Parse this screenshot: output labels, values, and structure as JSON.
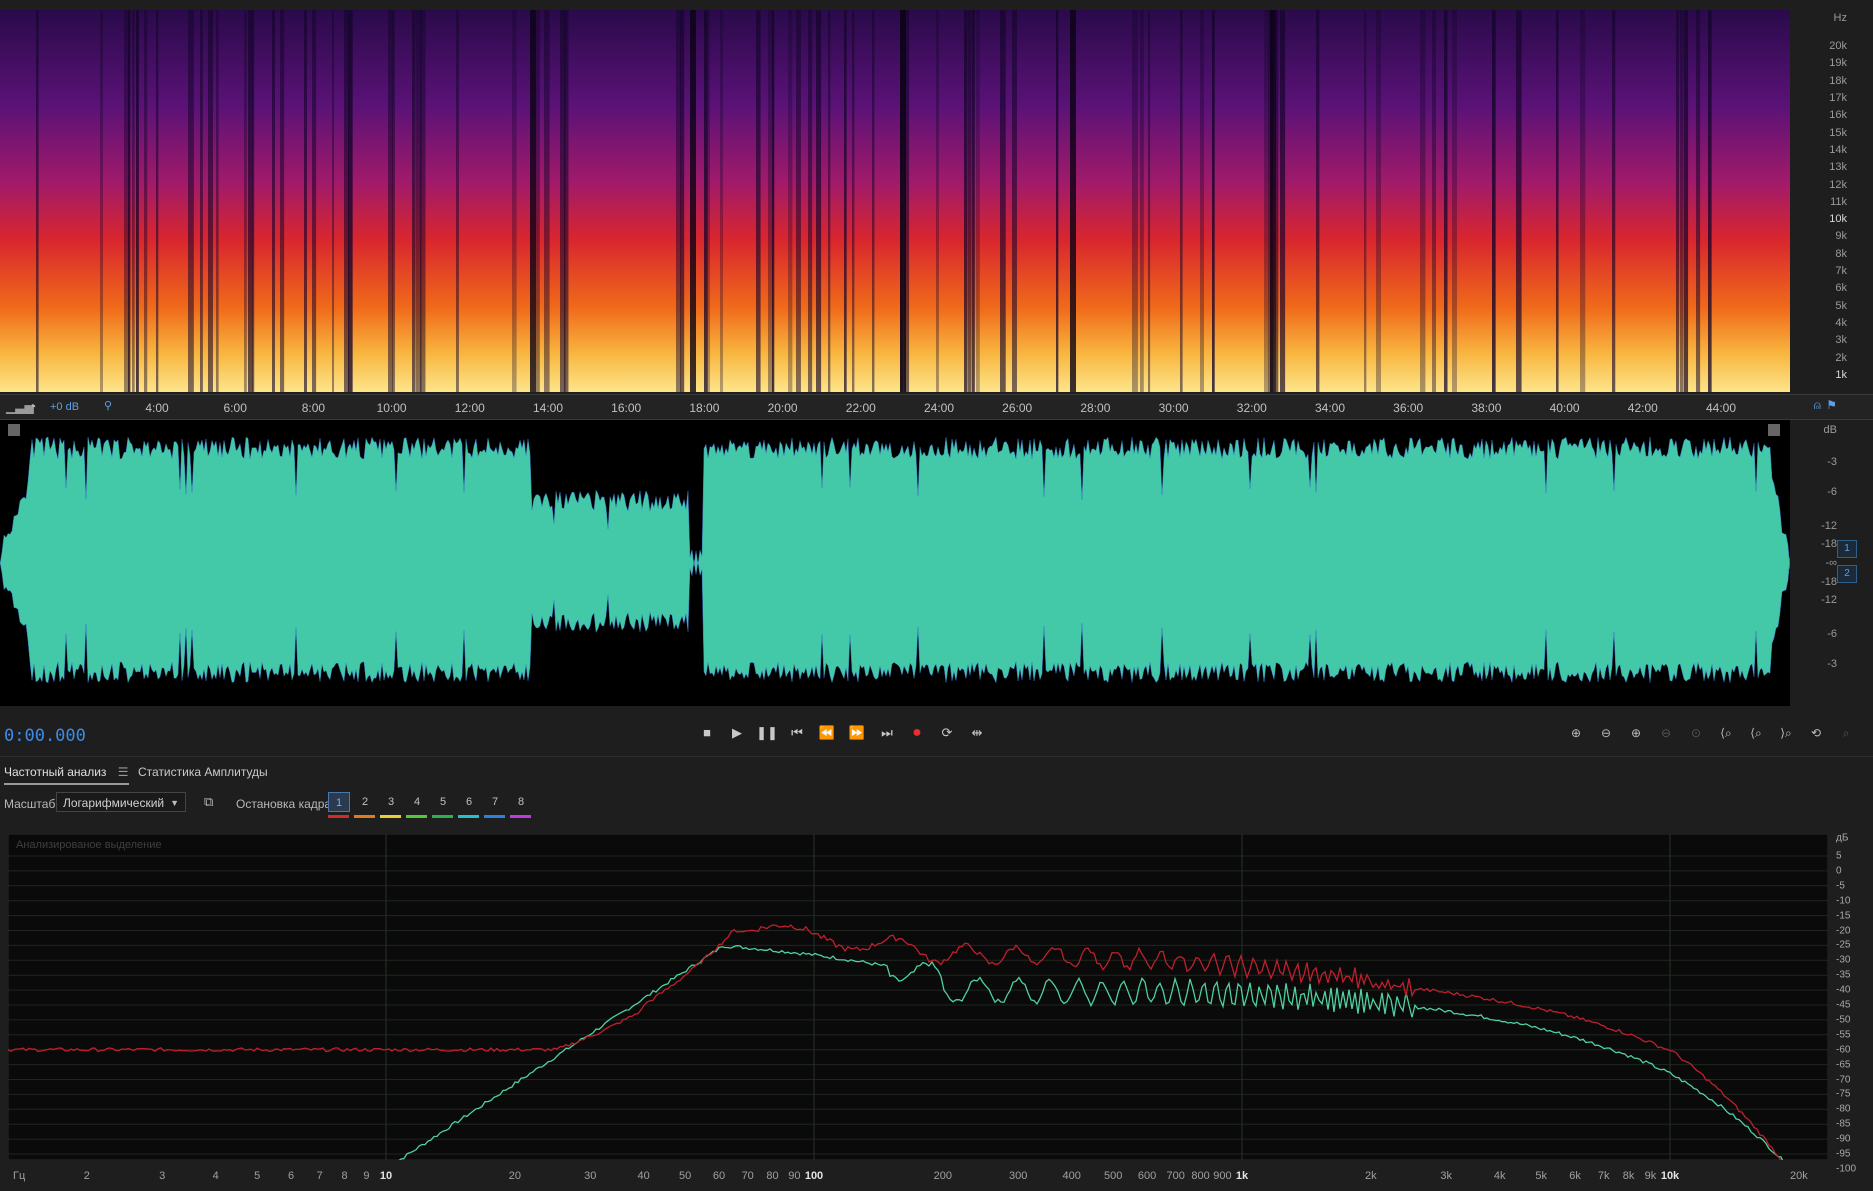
{
  "spectral": {
    "hz_unit": "Hz",
    "hz_labels": [
      "20k",
      "19k",
      "18k",
      "17k",
      "16k",
      "15k",
      "14k",
      "13k",
      "12k",
      "11k",
      "10k",
      "9k",
      "8k",
      "7k",
      "6k",
      "5k",
      "4k",
      "3k",
      "2k",
      "1k"
    ]
  },
  "timeline": {
    "gain": "+0 dB",
    "ticks": [
      "4:00",
      "6:00",
      "8:00",
      "10:00",
      "12:00",
      "14:00",
      "16:00",
      "18:00",
      "20:00",
      "22:00",
      "24:00",
      "26:00",
      "28:00",
      "30:00",
      "32:00",
      "34:00",
      "36:00",
      "38:00",
      "40:00",
      "42:00",
      "44:00"
    ]
  },
  "waveform": {
    "db_unit": "dB",
    "db_labels": [
      "-3",
      "-6",
      "-12",
      "-18",
      "-∞",
      "-18",
      "-12",
      "-6",
      "-3"
    ],
    "channels": [
      "1",
      "2"
    ],
    "color": "#44c9a8"
  },
  "transport": {
    "timecode": "0:00.000"
  },
  "panel": {
    "tabs": [
      "Частотный анализ",
      "Статистика Амплитуды"
    ],
    "scale_label": "Масштаб:",
    "scale_value": "Логарифмический",
    "freeze_label": "Остановка кадра:",
    "frames": [
      "1",
      "2",
      "3",
      "4",
      "5",
      "6",
      "7",
      "8"
    ],
    "frame_colors": [
      "#d42a2a",
      "#e07b1f",
      "#e5d22a",
      "#55c83a",
      "#2fb050",
      "#25c0d0",
      "#2e7fe0",
      "#c03adf"
    ],
    "analyzed_label": "Анализированое выделение",
    "freq_unit": "Гц",
    "freq_labels": [
      "2",
      "3",
      "4",
      "5",
      "6",
      "7",
      "8",
      "9",
      "10",
      "20",
      "30",
      "40",
      "50",
      "60",
      "70",
      "80",
      "90",
      "100",
      "200",
      "300",
      "400",
      "500",
      "600",
      "700",
      "800",
      "900",
      "1k",
      "2k",
      "3k",
      "4k",
      "5k",
      "6k",
      "7k",
      "8k",
      "9k",
      "10k",
      "20k"
    ],
    "db_unit": "дБ",
    "db_labels": [
      "5",
      "0",
      "-5",
      "-10",
      "-15",
      "-20",
      "-25",
      "-30",
      "-35",
      "-40",
      "-45",
      "-50",
      "-55",
      "-60",
      "-65",
      "-70",
      "-75",
      "-80",
      "-85",
      "-90",
      "-95",
      "-100"
    ]
  }
}
